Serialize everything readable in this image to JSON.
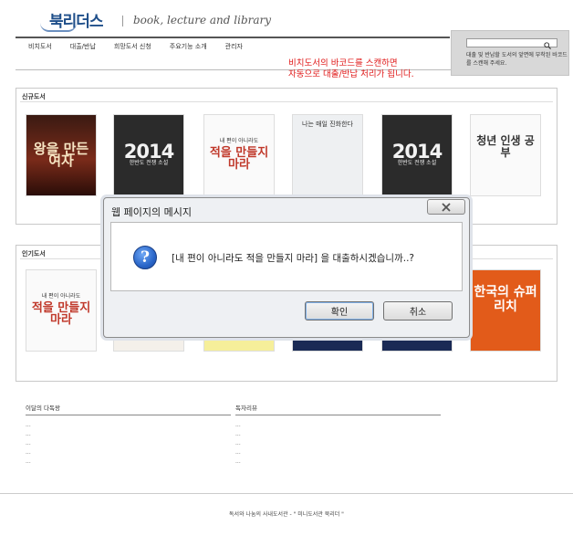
{
  "header": {
    "logo_text": "북리더스",
    "tagline": "book, lecture and library"
  },
  "nav": {
    "items": [
      {
        "label": "비치도서"
      },
      {
        "label": "대출/반납"
      },
      {
        "label": "희망도서 신청"
      },
      {
        "label": "주요기능 소개"
      },
      {
        "label": "관리자"
      }
    ]
  },
  "search": {
    "icon": "search-icon",
    "help_text": "대출 및 반납할 도서의 앞면에 부착된 바코드를 스캔해 주세요."
  },
  "annotation": {
    "line1": "비치도서의 바코드를 스캔하면",
    "line2": "자동으로 대출/반납 처리가 됩니다."
  },
  "sections": {
    "new": {
      "title": "신규도서"
    },
    "popular": {
      "title": "인기도서"
    }
  },
  "books": {
    "new": [
      {
        "title": "왕을 만든 여자",
        "sub": ""
      },
      {
        "title": "2014",
        "sub": "한반도 전쟁 소설"
      },
      {
        "title": "적을 만들지 마라",
        "sub": "내 편이 아니라도"
      },
      {
        "title": "",
        "sub": "나는 매일 진화한다"
      },
      {
        "title": "2014",
        "sub": "한반도 전쟁 소설"
      },
      {
        "title": "청년 인생 공부",
        "sub": ""
      }
    ],
    "popular": [
      {
        "title": "적을 만들지 마라",
        "sub": "내 편이 아니라도"
      },
      {
        "title": "",
        "sub": ""
      },
      {
        "title": "",
        "sub": ""
      },
      {
        "title": "",
        "sub": ""
      },
      {
        "title": "",
        "sub": ""
      },
      {
        "title": "한국의 슈퍼리치",
        "sub": ""
      }
    ]
  },
  "dialog": {
    "title": "웹 페이지의 메시지",
    "message": "[내 편이 아니라도 적을 만들지 마라] 을 대출하시겠습니까..?",
    "ok_label": "확인",
    "cancel_label": "취소",
    "close_icon": "close-icon",
    "question_icon": "question-icon"
  },
  "mini_sections": {
    "monthly": {
      "title": "이달의 다독왕",
      "items": [
        "...",
        "...",
        "...",
        "...",
        "..."
      ]
    },
    "reviews": {
      "title": "독자리뷰",
      "items": [
        "...",
        "...",
        "...",
        "...",
        "..."
      ]
    }
  },
  "footer": {
    "text": "독서와 나눔의 사내도서관 - \" 미니도서관 북리더 \""
  }
}
